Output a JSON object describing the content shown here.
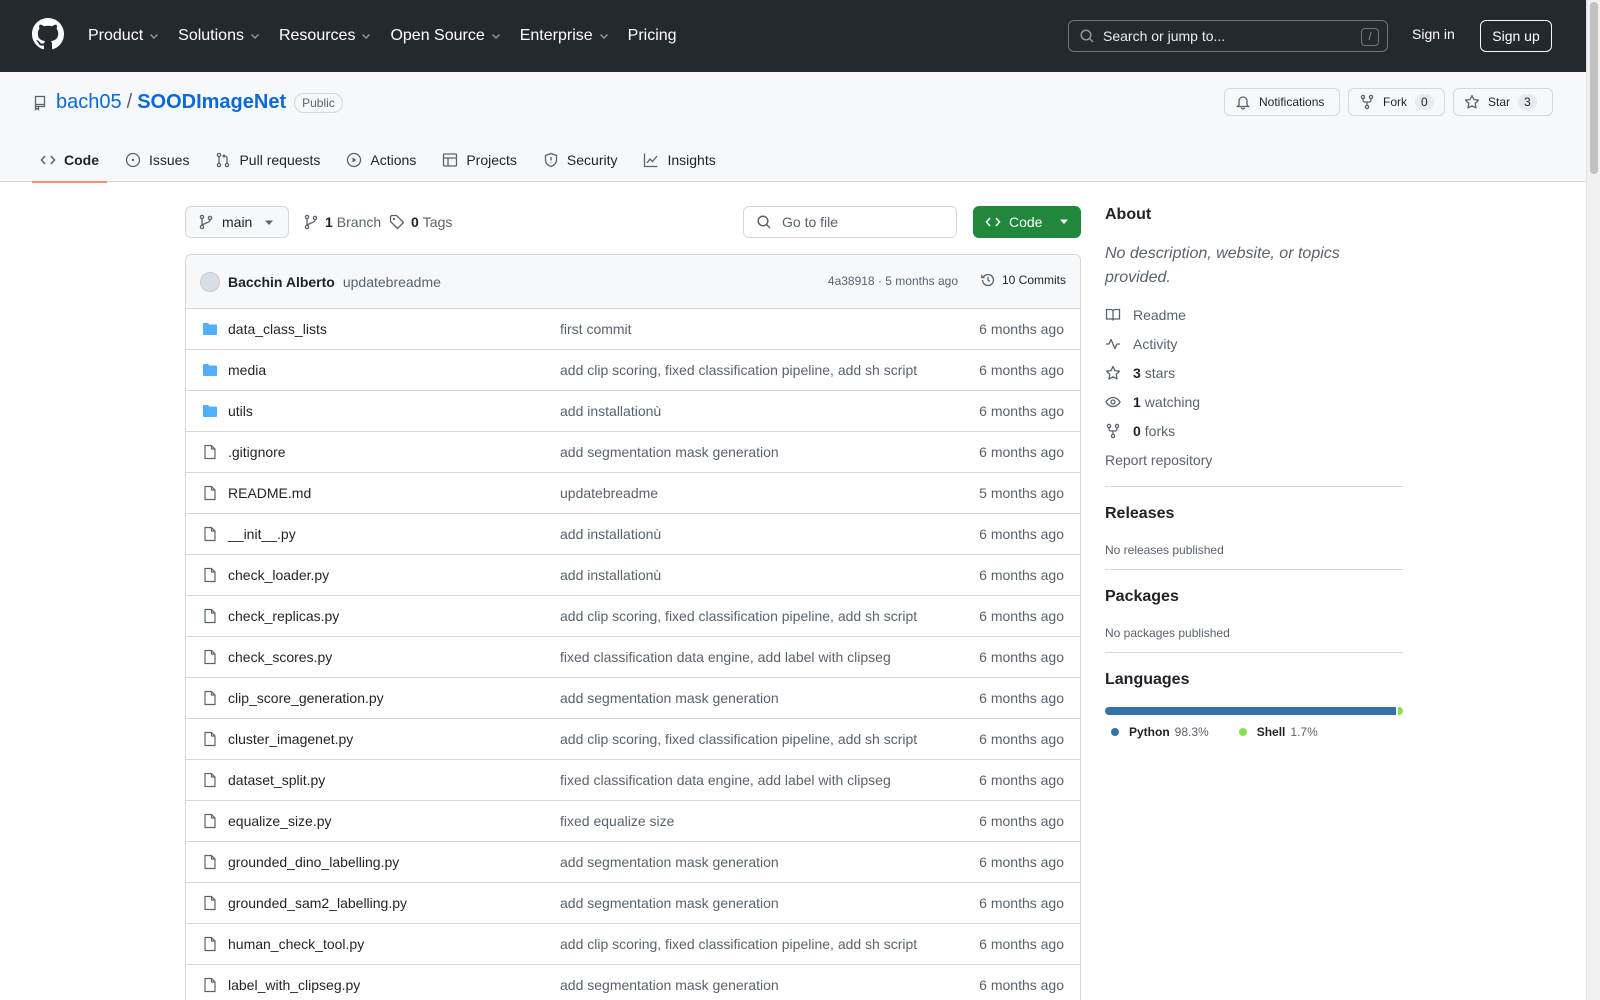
{
  "header": {
    "nav": [
      "Product",
      "Solutions",
      "Resources",
      "Open Source",
      "Enterprise",
      "Pricing"
    ],
    "search_placeholder": "Search or jump to...",
    "search_key": "/",
    "signin": "Sign in",
    "signup": "Sign up"
  },
  "repo": {
    "owner": "bach05",
    "separator": "/",
    "name": "SOODImageNet",
    "visibility": "Public",
    "notifications": "Notifications",
    "fork_label": "Fork",
    "fork_count": "0",
    "star_label": "Star",
    "star_count": "3",
    "tabs": [
      "Code",
      "Issues",
      "Pull requests",
      "Actions",
      "Projects",
      "Security",
      "Insights"
    ]
  },
  "toolbar": {
    "branch": "main",
    "branch_count": "1",
    "branch_label": "Branch",
    "tag_count": "0",
    "tag_label": "Tags",
    "goto_placeholder": "Go to file",
    "code_label": "Code"
  },
  "commit": {
    "author": "Bacchin Alberto",
    "message": "updatebreadme",
    "sha_time": "4a38918 · 5 months ago",
    "commits": "10 Commits"
  },
  "files": [
    {
      "name": "data_class_lists",
      "type": "dir",
      "msg": "first commit",
      "age": "6 months ago"
    },
    {
      "name": "media",
      "type": "dir",
      "msg": "add clip scoring, fixed classification pipeline, add sh script",
      "age": "6 months ago"
    },
    {
      "name": "utils",
      "type": "dir",
      "msg": "add installationù",
      "age": "6 months ago"
    },
    {
      "name": ".gitignore",
      "type": "file",
      "msg": "add segmentation mask generation",
      "age": "6 months ago"
    },
    {
      "name": "README.md",
      "type": "file",
      "msg": "updatebreadme",
      "age": "5 months ago"
    },
    {
      "name": "__init__.py",
      "type": "file",
      "msg": "add installationù",
      "age": "6 months ago"
    },
    {
      "name": "check_loader.py",
      "type": "file",
      "msg": "add installationù",
      "age": "6 months ago"
    },
    {
      "name": "check_replicas.py",
      "type": "file",
      "msg": "add clip scoring, fixed classification pipeline, add sh script",
      "age": "6 months ago"
    },
    {
      "name": "check_scores.py",
      "type": "file",
      "msg": "fixed classification data engine, add label with clipseg",
      "age": "6 months ago"
    },
    {
      "name": "clip_score_generation.py",
      "type": "file",
      "msg": "add segmentation mask generation",
      "age": "6 months ago"
    },
    {
      "name": "cluster_imagenet.py",
      "type": "file",
      "msg": "add clip scoring, fixed classification pipeline, add sh script",
      "age": "6 months ago"
    },
    {
      "name": "dataset_split.py",
      "type": "file",
      "msg": "fixed classification data engine, add label with clipseg",
      "age": "6 months ago"
    },
    {
      "name": "equalize_size.py",
      "type": "file",
      "msg": "fixed equalize size",
      "age": "6 months ago"
    },
    {
      "name": "grounded_dino_labelling.py",
      "type": "file",
      "msg": "add segmentation mask generation",
      "age": "6 months ago"
    },
    {
      "name": "grounded_sam2_labelling.py",
      "type": "file",
      "msg": "add segmentation mask generation",
      "age": "6 months ago"
    },
    {
      "name": "human_check_tool.py",
      "type": "file",
      "msg": "add clip scoring, fixed classification pipeline, add sh script",
      "age": "6 months ago"
    },
    {
      "name": "label_with_clipseg.py",
      "type": "file",
      "msg": "add segmentation mask generation",
      "age": "6 months ago"
    }
  ],
  "sidebar": {
    "about_title": "About",
    "about_desc": "No description, website, or topics provided.",
    "readme": "Readme",
    "activity": "Activity",
    "stars_count": "3",
    "stars_label": "stars",
    "watching_count": "1",
    "watching_label": "watching",
    "forks_count": "0",
    "forks_label": "forks",
    "report": "Report repository",
    "releases_title": "Releases",
    "releases_none": "No releases published",
    "packages_title": "Packages",
    "packages_none": "No packages published",
    "languages_title": "Languages",
    "languages": [
      {
        "name": "Python",
        "pct": "98.3%",
        "value": 98.3,
        "color": "#3572A5"
      },
      {
        "name": "Shell",
        "pct": "1.7%",
        "value": 1.7,
        "color": "#89e051"
      }
    ]
  },
  "colors": {
    "header_bg": "#24292f",
    "accent_link": "#0969da",
    "code_button": "#1f883d",
    "active_tab_underline": "#fd8c73",
    "folder_icon": "#54aeff"
  }
}
